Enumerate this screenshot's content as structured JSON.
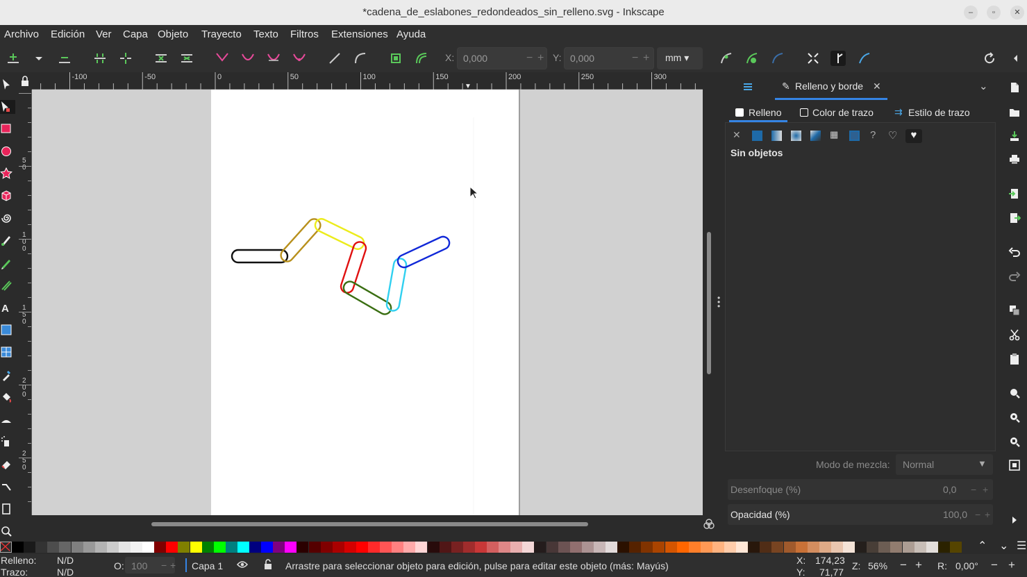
{
  "window": {
    "title": "*cadena_de_eslabones_redondeados_sin_relleno.svg - Inkscape",
    "controls": [
      "–",
      "▫",
      "✕"
    ]
  },
  "menu": [
    "Archivo",
    "Edición",
    "Ver",
    "Capa",
    "Objeto",
    "Trayecto",
    "Texto",
    "Filtros",
    "Extensiones",
    "Ayuda"
  ],
  "controls_bar": {
    "x_label": "X:",
    "x_value": "0,000",
    "y_label": "Y:",
    "y_value": "0,000",
    "unit": "mm",
    "icons": [
      "insert-node-icon",
      "insert-node-menu-icon",
      "delete-node-icon",
      "join-nodes-icon",
      "break-path-icon",
      "join-endnodes-icon",
      "delete-segment-icon",
      "node-cusp-icon",
      "node-smooth-icon",
      "node-symmetric-icon",
      "node-auto-icon",
      "segment-line-icon",
      "segment-curve-icon",
      "object-to-path-icon",
      "stroke-to-path-icon"
    ],
    "right_icons": [
      "edit-clippath-icon",
      "edit-mask-icon",
      "show-lpe-icon",
      "show-transform-handles-icon",
      "show-handles-icon",
      "show-outline-icon",
      "snap-toggle-icon",
      "dock-toggle-icon"
    ]
  },
  "rulers": {
    "horizontal": [
      "-100",
      "-50",
      "0",
      "50",
      "100",
      "150",
      "200",
      "250",
      "300"
    ],
    "vertical": [
      "5\n0",
      "1\n0\n0",
      "1\n5\n0",
      "2\n0\n0",
      "2\n5\n0"
    ]
  },
  "tools": [
    "selector-icon",
    "node-tool-icon",
    "rectangle-icon",
    "ellipse-icon",
    "star-icon",
    "3d-box-icon",
    "spiral-icon",
    "pen-icon",
    "pencil-icon",
    "calligraphy-icon",
    "text-icon",
    "gradient-icon",
    "mesh-icon",
    "dropper-icon",
    "paint-bucket-icon",
    "tweak-icon",
    "spray-icon",
    "eraser-icon",
    "connector-icon",
    "pages-icon",
    "zoom-icon"
  ],
  "canvas": {
    "links": [
      {
        "name": "black-link",
        "color": "#111111"
      },
      {
        "name": "ochre-link",
        "color": "#b8901c"
      },
      {
        "name": "yellow-link",
        "color": "#ecec1c"
      },
      {
        "name": "red-link",
        "color": "#e01010"
      },
      {
        "name": "green-link",
        "color": "#3a6e12"
      },
      {
        "name": "cyan-link",
        "color": "#30d0f0"
      },
      {
        "name": "blue-link",
        "color": "#1028d8"
      }
    ]
  },
  "dock": {
    "panel_tab": "Relleno y borde",
    "subtabs": [
      "Relleno",
      "Color de trazo",
      "Estilo de trazo"
    ],
    "paint_modes": [
      "no-paint-icon",
      "flat-color-icon",
      "linear-gradient-icon",
      "radial-gradient-icon",
      "mesh-gradient-icon",
      "pattern-icon",
      "swatch-icon",
      "unset-paint-icon",
      "evenodd-icon",
      "nonzero-icon"
    ],
    "empty_message": "Sin objetos",
    "blend_label": "Modo de mezcla:",
    "blend_value": "Normal",
    "blur_label": "Desenfoque (%)",
    "blur_value": "0,0",
    "opacity_label": "Opacidad (%)",
    "opacity_value": "100,0"
  },
  "commands": [
    "new-document-icon",
    "open-icon",
    "save-icon",
    "print-icon",
    "import-icon",
    "export-icon",
    "undo-icon",
    "redo-icon",
    "duplicate-icon",
    "cut-icon",
    "paste-icon",
    "zoom-selection-icon",
    "zoom-drawing-icon",
    "zoom-page-icon",
    "zoom-center-icon"
  ],
  "palette": [
    "#000000",
    "#1a1a1a",
    "#333333",
    "#4d4d4d",
    "#666666",
    "#808080",
    "#999999",
    "#b3b3b3",
    "#cccccc",
    "#e6e6e6",
    "#f2f2f2",
    "#ffffff",
    "#800000",
    "#ff0000",
    "#808000",
    "#ffff00",
    "#008000",
    "#00ff00",
    "#008080",
    "#00ffff",
    "#000080",
    "#0000ff",
    "#800080",
    "#ff00ff",
    "#2b0000",
    "#550000",
    "#800000",
    "#aa0000",
    "#d40000",
    "#ff0000",
    "#ff2a2a",
    "#ff5555",
    "#ff8080",
    "#ffaaaa",
    "#ffd5d5",
    "#280b0b",
    "#501616",
    "#782121",
    "#a02c2c",
    "#c83737",
    "#d35f5f",
    "#de8787",
    "#e9afaf",
    "#f4d7d7",
    "#241c1c",
    "#483737",
    "#6c5353",
    "#916f6f",
    "#ac9393",
    "#c8b7b7",
    "#e3dbdb",
    "#2b1100",
    "#552200",
    "#803300",
    "#aa4400",
    "#d45500",
    "#ff6600",
    "#ff7f2a",
    "#ff9955",
    "#ffb380",
    "#ffccaa",
    "#ffe6d5",
    "#28170b",
    "#502d16",
    "#784421",
    "#a05a2c",
    "#c87137",
    "#d38d5f",
    "#deaa87",
    "#e9c6af",
    "#f4e3d7",
    "#241f1c",
    "#483e37",
    "#6c5d53",
    "#917c6f",
    "#ac9d93",
    "#c8beb7",
    "#e3dedb",
    "#2b2200",
    "#554400"
  ],
  "status": {
    "fill_label": "Relleno:",
    "fill_value": "N/D",
    "stroke_label": "Trazo:",
    "stroke_value": "N/D",
    "opacity_label": "O:",
    "opacity_value": "100",
    "layer": "Capa 1",
    "message": "Arrastre para seleccionar objeto para edición, pulse para editar este objeto (más: Mayús)",
    "x_label": "X:",
    "x_value": "174,23",
    "y_label": "Y:",
    "y_value": "71,77",
    "zoom_label": "Z:",
    "zoom_value": "56%",
    "rotation_label": "R:",
    "rotation_value": "0,00°"
  }
}
